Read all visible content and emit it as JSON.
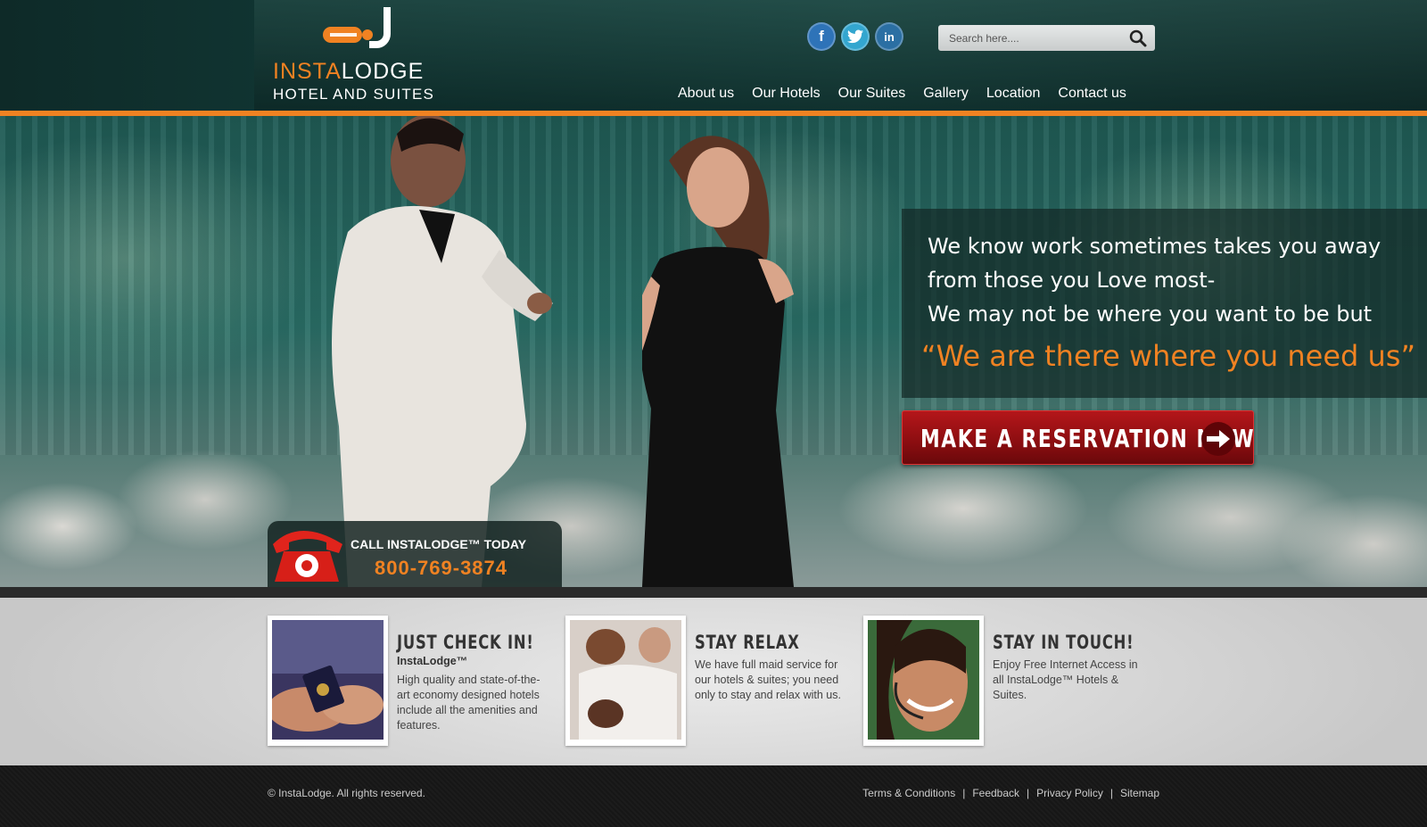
{
  "header": {
    "logo": {
      "brand_highlight": "INSTA",
      "brand_rest": "LODGE",
      "subtitle": "HOTEL AND SUITES"
    },
    "social": [
      {
        "name": "facebook",
        "glyph": "f",
        "color": "#2e73b8"
      },
      {
        "name": "twitter",
        "glyph": "t",
        "color": "#33a6cf"
      },
      {
        "name": "linkedin",
        "glyph": "in",
        "color": "#2b6fa3"
      }
    ],
    "search": {
      "placeholder": "Search here...."
    },
    "nav": [
      "About us",
      "Our Hotels",
      "Our Suites",
      "Gallery",
      "Location",
      "Contact us"
    ]
  },
  "hero": {
    "tagline_lines": [
      "We know work sometimes takes you away",
      "from those you Love most-",
      "We may not be where you want to be but"
    ],
    "tagline_quote": "“We are there where you need us”",
    "reserve_label": "MAKE A RESERVATION NOW",
    "call_label": "CALL INSTALODGE™ TODAY",
    "call_number": "800-769-3874"
  },
  "features": [
    {
      "title": "JUST CHECK IN!",
      "subtitle": "InstaLodge™",
      "text": "High quality and state-of-the-art economy designed hotels include all the amenities and features."
    },
    {
      "title": "STAY RELAX",
      "subtitle": "",
      "text": "We have full maid service for our hotels & suites; you need only to stay and relax with us."
    },
    {
      "title": "STAY IN TOUCH!",
      "subtitle": "",
      "text": "Enjoy Free Internet Access in all InstaLodge™ Hotels & Suites."
    }
  ],
  "footer": {
    "copyright": "© InstaLodge. All rights reserved.",
    "links": [
      "Terms & Conditions",
      "Feedback",
      "Privacy Policy",
      "Sitemap"
    ]
  },
  "colors": {
    "accent": "#f08222",
    "reserve": "#9e1215",
    "header_bg": "#123a37"
  }
}
